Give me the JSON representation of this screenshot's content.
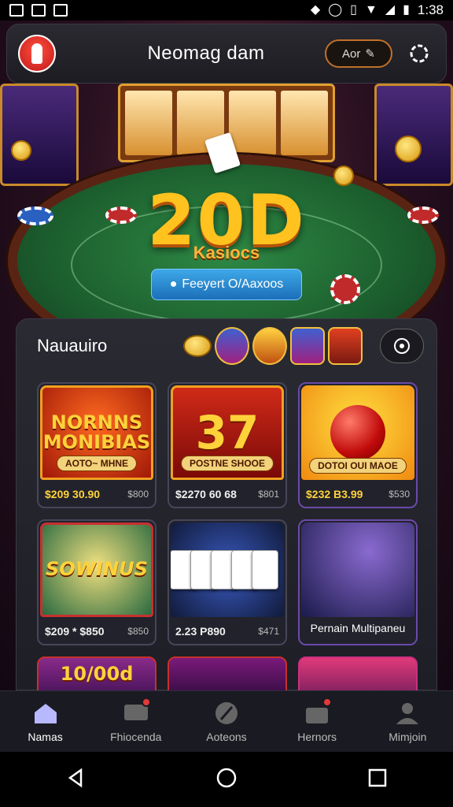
{
  "status_bar": {
    "time": "1:38",
    "left_icons": [
      "image-icon",
      "image-icon",
      "image-icon"
    ],
    "right_icons": [
      "alert-icon",
      "circle-icon",
      "vibrate-icon",
      "wifi-icon",
      "signal-icon",
      "battery-icon"
    ]
  },
  "header": {
    "title": "Neomag dam",
    "search_label": "Aor",
    "avatar_icon": "avatar-icon",
    "settings_icon": "settings-icon"
  },
  "hero": {
    "amount": "20D",
    "subtitle": "Kasiocs",
    "button_label": "Feeyert O/Aaxoos"
  },
  "section": {
    "title": "Nauauiro"
  },
  "games": [
    {
      "title_art": "NORNNS MONIBIAS",
      "tag": "AOTO~ MHNE",
      "price": "$209 30.90",
      "meta": "$800"
    },
    {
      "title_art": "37",
      "tag": "POSTNE SHOOE",
      "price": "$2270 60 68",
      "meta": "$801"
    },
    {
      "title_art": "",
      "tag": "DOTOI OUI MAOE",
      "price": "$232  B3.99",
      "meta": "$530"
    },
    {
      "title_art": "SOWINUS",
      "tag": "",
      "price": "$209 * $850",
      "meta": "$850"
    },
    {
      "title_art": "",
      "tag": "",
      "price": "2.23  P890",
      "meta": "$471"
    },
    {
      "title_art": "",
      "tag": "",
      "caption": "Pernain Multipaneu"
    },
    {
      "title_art": "10/00d",
      "tag": "",
      "price": "",
      "meta": ""
    },
    {
      "title_art": "",
      "tag": "",
      "price": "",
      "meta": ""
    },
    {
      "title_art": "",
      "tag": "",
      "price": "",
      "meta": ""
    }
  ],
  "bottom_nav": [
    {
      "label": "Namas",
      "icon": "home-icon",
      "active": true
    },
    {
      "label": "Fhiocenda",
      "icon": "chat-icon",
      "badge": true
    },
    {
      "label": "Aoteons",
      "icon": "compass-icon"
    },
    {
      "label": "Hernors",
      "icon": "bag-icon",
      "badge": true
    },
    {
      "label": "Mimjoin",
      "icon": "profile-icon"
    }
  ],
  "colors": {
    "accent_gold": "#ffc21e",
    "button_blue": "#2a86d0",
    "panel_bg": "#24242c",
    "badge_red": "#e03a3a"
  }
}
